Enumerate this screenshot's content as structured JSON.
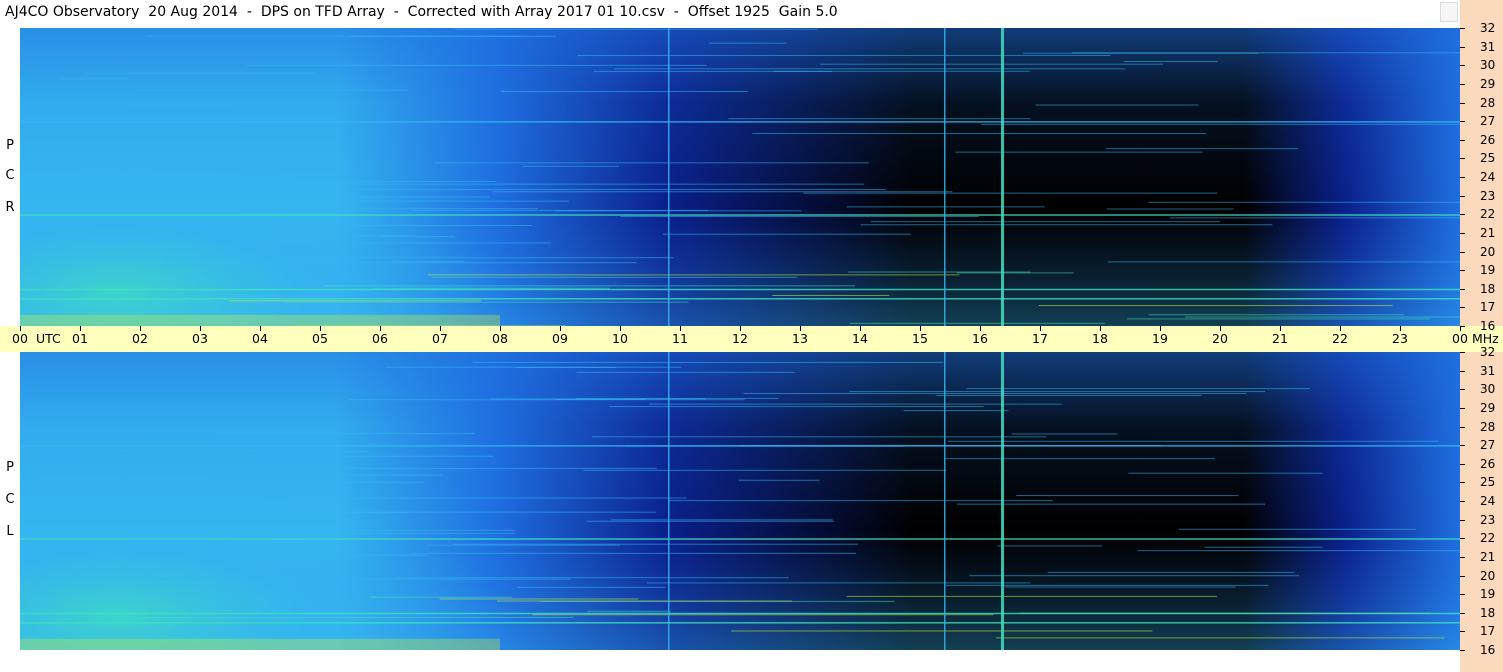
{
  "title": "AJ4CO Observatory  20 Aug 2014  -  DPS on TFD Array  -  Corrected with Array 2017 01 10.csv  -  Offset 1925  Gain 5.0",
  "panels": [
    {
      "id": "rcp",
      "label_letters": [
        "R",
        "C",
        "P"
      ]
    },
    {
      "id": "lcp",
      "label_letters": [
        "L",
        "C",
        "P"
      ]
    }
  ],
  "x_axis": {
    "ticks": [
      "00",
      "01",
      "02",
      "03",
      "04",
      "05",
      "06",
      "07",
      "08",
      "09",
      "10",
      "11",
      "12",
      "13",
      "14",
      "15",
      "16",
      "17",
      "18",
      "19",
      "20",
      "21",
      "22",
      "23",
      "00"
    ],
    "unit_label": "UTC",
    "end_unit": "MHz"
  },
  "y_axis_ticks": [
    "32",
    "31",
    "30",
    "29",
    "28",
    "27",
    "26",
    "25",
    "24",
    "23",
    "22",
    "21",
    "20",
    "19",
    "18",
    "17",
    "16"
  ],
  "colors": {
    "deep": "#000000",
    "dark_blue": "#0a1f8a",
    "blue": "#1f6fe0",
    "light_blue": "#35b6f0",
    "cyan_green": "#40e0c0",
    "yellow_green": "#c8f040",
    "axis_bar": "#ffffbe",
    "right_strip": "#fbd9bd"
  },
  "chart_data": {
    "type": "heatmap",
    "title": "AJ4CO Observatory  20 Aug 2014  -  DPS on TFD Array  -  Corrected with Array 2017 01 10.csv  -  Offset 1925  Gain 5.0",
    "xlabel": "UTC",
    "ylabel": "MHz",
    "xlim": [
      0,
      24
    ],
    "ylim": [
      16,
      32
    ],
    "series": [
      {
        "name": "RCP",
        "values": []
      },
      {
        "name": "LCP",
        "values": []
      }
    ],
    "features": {
      "daytime_dark_region_utc": [
        8,
        21
      ],
      "strong_vertical_lines_utc": [
        10.8,
        15.4,
        16.35
      ],
      "bright_horizontal_bands_mhz": [
        27,
        22,
        18,
        17.5
      ]
    }
  }
}
